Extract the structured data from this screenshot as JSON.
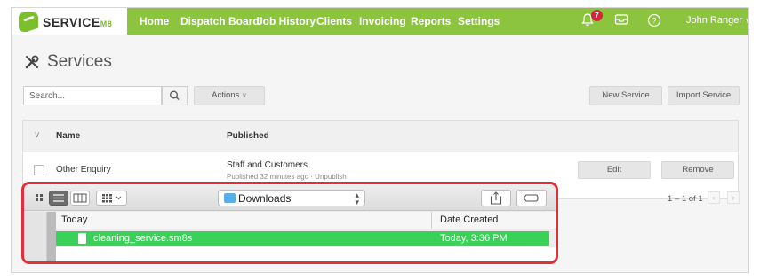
{
  "app": {
    "logo_text": "SERVICE",
    "logo_suffix": "M8"
  },
  "nav": {
    "items": [
      "Home",
      "Dispatch Board",
      "Job History",
      "Clients",
      "Invoicing",
      "Reports",
      "Settings"
    ],
    "notification_count": "7",
    "user_name": "John Ranger",
    "icons": [
      "bell-icon",
      "inbox-icon",
      "help-icon",
      "chevron-down-icon"
    ]
  },
  "page": {
    "title": "Services"
  },
  "toolbar": {
    "search_placeholder": "Search...",
    "actions_label": "Actions",
    "new_service_label": "New Service",
    "import_service_label": "Import Service"
  },
  "table": {
    "headers": {
      "name": "Name",
      "published": "Published"
    },
    "rows": [
      {
        "name": "Other Enquiry",
        "published": "Staff and Customers",
        "published_detail": "Published 32 minutes ago · Unpublish",
        "edit_label": "Edit",
        "remove_label": "Remove"
      }
    ]
  },
  "pagination": {
    "label": "1 – 1 of 1"
  },
  "file_dialog": {
    "location": "Downloads",
    "columns": {
      "name": "Today",
      "date": "Date Created"
    },
    "files": [
      {
        "name": "cleaning_service.sm8s",
        "date": "Today, 3:36 PM",
        "selected": true
      }
    ]
  },
  "colors": {
    "nav_green": "#8cc43f",
    "highlight_red": "#e0303c",
    "selection_green": "#3ad158",
    "badge_red": "#d0283a"
  }
}
